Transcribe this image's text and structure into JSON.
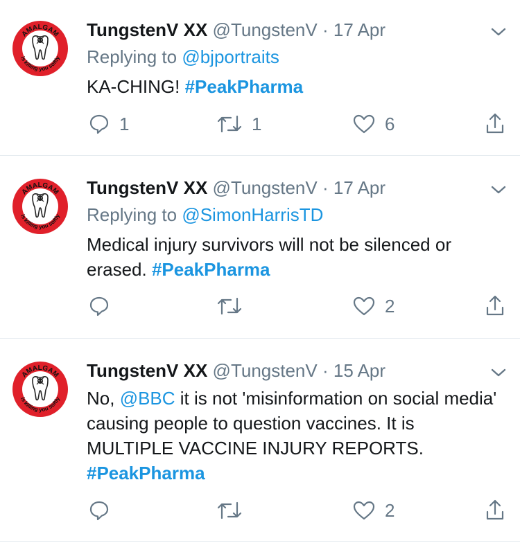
{
  "colors": {
    "link": "#1b95e0",
    "meta": "#657786",
    "text": "#14171a",
    "divider": "#e6ecf0",
    "avatar_ring": "#e0202a"
  },
  "avatar_logo": {
    "top": "AMALGAM",
    "bottom": "is killing you softly"
  },
  "tweets": [
    {
      "name": "TungstenV XX",
      "handle": "@TungstenV",
      "sep": "·",
      "date": "17 Apr",
      "reply_prefix": "Replying to",
      "reply_to": "@bjportraits",
      "text_a": "KA-CHING! ",
      "tag": "#PeakPharma",
      "counts": {
        "replies": "1",
        "retweets": "1",
        "likes": "6"
      }
    },
    {
      "name": "TungstenV XX",
      "handle": "@TungstenV",
      "sep": "·",
      "date": "17 Apr",
      "reply_prefix": "Replying to",
      "reply_to": "@SimonHarrisTD",
      "text_a": "Medical injury survivors will not be silenced or erased. ",
      "tag": "#PeakPharma",
      "counts": {
        "replies": "",
        "retweets": "",
        "likes": "2"
      }
    },
    {
      "name": "TungstenV XX",
      "handle": "@TungstenV",
      "sep": "·",
      "date": "15 Apr",
      "text_pre": "No, ",
      "mention": "@BBC",
      "text_a": " it is not 'misinformation on social media' causing people to question vaccines. It is MULTIPLE VACCINE INJURY REPORTS.",
      "tag": "#PeakPharma",
      "counts": {
        "replies": "",
        "retweets": "",
        "likes": "2"
      }
    }
  ],
  "icons": {
    "reply": "reply-icon",
    "retweet": "retweet-icon",
    "like": "heart-icon",
    "share": "share-icon",
    "more": "chevron-down-icon"
  }
}
